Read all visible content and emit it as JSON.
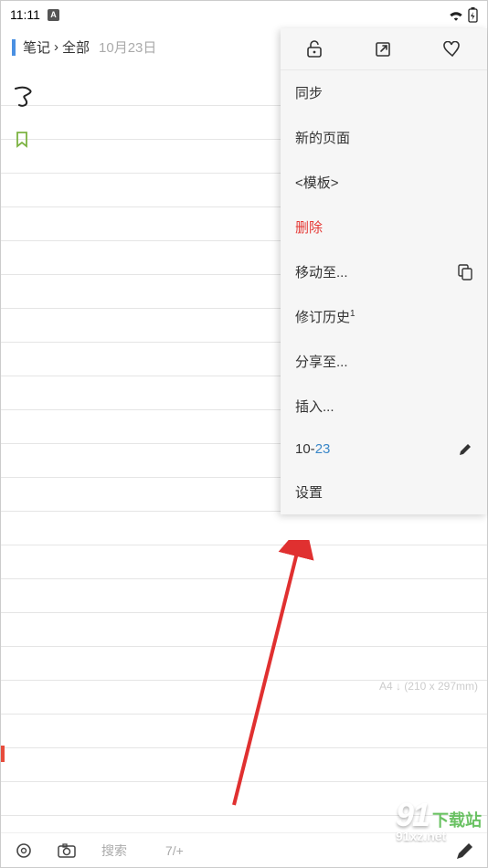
{
  "statusBar": {
    "time": "11:11"
  },
  "breadcrumb": {
    "part1": "笔记",
    "sep": "›",
    "part2": "全部",
    "date": "10月23日"
  },
  "pageSize": "A4 ↓ (210 x 297mm)",
  "bottomBar": {
    "search": "搜索",
    "pages": "7/+"
  },
  "menu": {
    "sync": "同步",
    "newPage": "新的页面",
    "template": "<模板>",
    "delete": "删除",
    "moveTo": "移动至...",
    "history": "修订历史",
    "historySup": "1",
    "shareTo": "分享至...",
    "insert": "插入...",
    "datePrefix": "10-",
    "dateSuffix": "23",
    "settings": "设置"
  },
  "watermark": {
    "brand": "91",
    "text": "下载站",
    "url": "91xz.net"
  }
}
